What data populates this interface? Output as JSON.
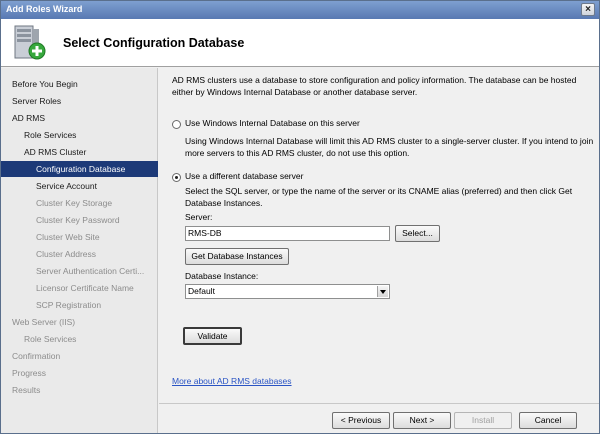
{
  "window": {
    "title": "Add Roles Wizard",
    "close_label": "×"
  },
  "header": {
    "title": "Select Configuration Database",
    "icon": "server-roles-icon"
  },
  "sidebar": {
    "items": [
      {
        "label": "Before You Begin",
        "state": "normal"
      },
      {
        "label": "Server Roles",
        "state": "normal"
      },
      {
        "label": "AD RMS",
        "state": "normal"
      },
      {
        "label": "Role Services",
        "state": "normal"
      },
      {
        "label": "AD RMS Cluster",
        "state": "normal"
      },
      {
        "label": "Configuration Database",
        "state": "active"
      },
      {
        "label": "Service Account",
        "state": "normal"
      },
      {
        "label": "Cluster Key Storage",
        "state": "muted"
      },
      {
        "label": "Cluster Key Password",
        "state": "muted"
      },
      {
        "label": "Cluster Web Site",
        "state": "muted"
      },
      {
        "label": "Cluster Address",
        "state": "muted"
      },
      {
        "label": "Server Authentication Certi...",
        "state": "muted"
      },
      {
        "label": "Licensor Certificate Name",
        "state": "muted"
      },
      {
        "label": "SCP Registration",
        "state": "muted"
      },
      {
        "label": "Web Server (IIS)",
        "state": "muted"
      },
      {
        "label": "Role Services",
        "state": "muted"
      },
      {
        "label": "Confirmation",
        "state": "muted"
      },
      {
        "label": "Progress",
        "state": "muted"
      },
      {
        "label": "Results",
        "state": "muted"
      }
    ]
  },
  "content": {
    "intro": "AD RMS clusters use a database to store configuration and policy information. The database can be hosted either by Windows Internal Database or another database server.",
    "option_internal": {
      "label": "Use Windows Internal Database on this server",
      "description": "Using Windows Internal Database will limit this AD RMS cluster to a single-server cluster. If you intend to join more servers to this AD RMS cluster, do not use this option.",
      "checked": false
    },
    "option_other": {
      "label": "Use a different database server",
      "description": "Select the SQL server, or type the name of the server or its CNAME alias (preferred) and then click Get Database Instances.",
      "checked": true
    },
    "server_label": "Server:",
    "server_value": "RMS-DB",
    "select_button": "Select...",
    "get_instances_button": "Get Database Instances",
    "instance_label": "Database Instance:",
    "instance_value": "Default",
    "validate_button": "Validate",
    "more_link": "More about AD RMS databases"
  },
  "footer": {
    "previous": "< Previous",
    "next": "Next >",
    "install": "Install",
    "cancel": "Cancel"
  },
  "colors": {
    "titlebar": "#6a8cc4",
    "active_item": "#1d3a78",
    "link": "#2a54c4"
  }
}
